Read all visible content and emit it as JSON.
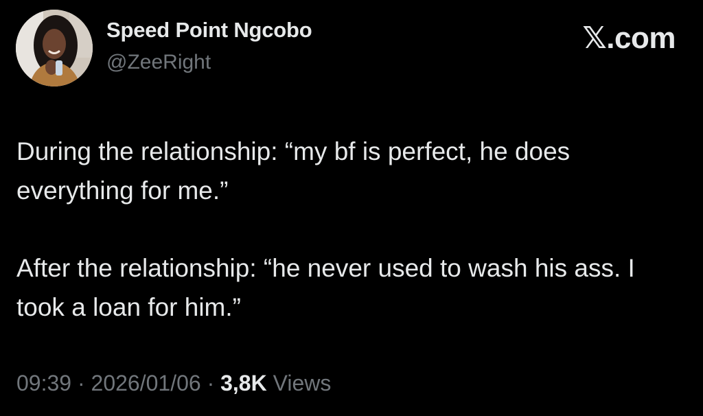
{
  "author": {
    "name": "Speed Point Ngcobo",
    "handle": "@ZeeRight"
  },
  "brand": "𝕏.com",
  "tweet": {
    "paragraphs": [
      "During the relationship: “my bf is perfect, he does everything for me.”",
      "After the relationship: “he never used to wash his ass. I took a loan for him.”"
    ]
  },
  "meta": {
    "time": "09:39",
    "separator": " · ",
    "date": "2026/01/06",
    "views_count": "3,8K",
    "views_label": " Views"
  },
  "colors": {
    "background": "#000000",
    "text_primary": "#e7e9ea",
    "text_secondary": "#71767b"
  },
  "icons": {
    "avatar": "profile-photo",
    "brand": "x-logo"
  }
}
